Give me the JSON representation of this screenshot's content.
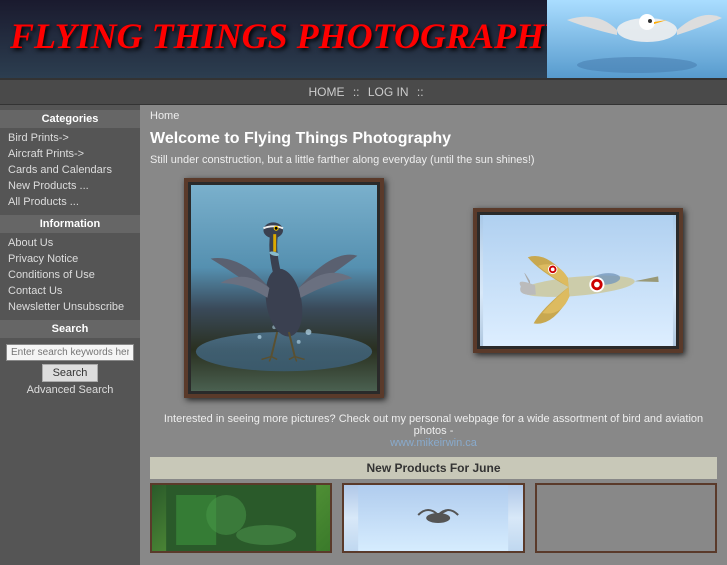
{
  "header": {
    "title": "FLYING THINGS PHOTOGRAPHY"
  },
  "navbar": {
    "items": [
      {
        "label": "HOME",
        "href": "#"
      },
      {
        "separator": "::"
      },
      {
        "label": "LOG IN",
        "href": "#"
      },
      {
        "separator": "::"
      }
    ]
  },
  "sidebar": {
    "categories_title": "Categories",
    "categories": [
      {
        "label": "Bird Prints->"
      },
      {
        "label": "Aircraft Prints->"
      },
      {
        "label": "Cards and Calendars"
      },
      {
        "label": "New Products ..."
      },
      {
        "label": "All Products ..."
      }
    ],
    "information_title": "Information",
    "information": [
      {
        "label": "About Us"
      },
      {
        "label": "Privacy Notice"
      },
      {
        "label": "Conditions of Use"
      },
      {
        "label": "Contact Us"
      },
      {
        "label": "Newsletter Unsubscribe"
      }
    ],
    "search_title": "Search",
    "search_placeholder": "Enter search keywords here",
    "search_button": "Search",
    "advanced_search": "Advanced Search"
  },
  "content": {
    "breadcrumb": "Home",
    "welcome_title": "Welcome to Flying Things Photography",
    "welcome_subtitle": "Still under construction, but a little farther along everyday (until the sun shines!)",
    "interested_text": "Interested in seeing more pictures? Check out my personal webpage for a wide assortment of bird and aviation photos -",
    "interested_link_text": "www.mikeirwin.ca",
    "new_products_title": "New Products For June"
  }
}
